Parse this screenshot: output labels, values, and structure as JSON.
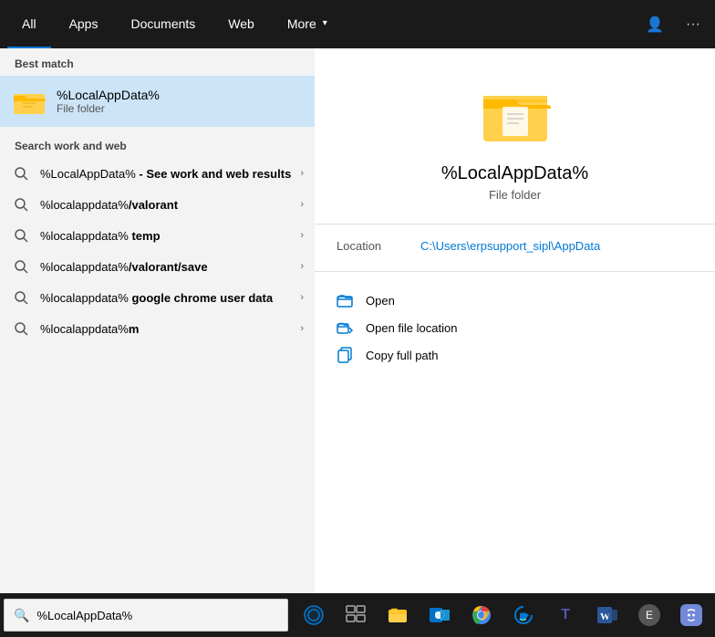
{
  "nav": {
    "tabs": [
      {
        "label": "All",
        "active": true
      },
      {
        "label": "Apps",
        "active": false
      },
      {
        "label": "Documents",
        "active": false
      },
      {
        "label": "Web",
        "active": false
      },
      {
        "label": "More",
        "active": false,
        "has_arrow": true
      }
    ],
    "right_icons": [
      "person-icon",
      "more-icon"
    ]
  },
  "left_panel": {
    "best_match_header": "Best match",
    "best_match": {
      "title": "%LocalAppData%",
      "subtitle": "File folder"
    },
    "search_web_header": "Search work and web",
    "search_items": [
      {
        "text_normal": "%LocalAppData%",
        "text_bold": "",
        "suffix": " - See work and web results"
      },
      {
        "text_normal": "%localappdata%",
        "text_bold": "/valorant",
        "suffix": ""
      },
      {
        "text_normal": "%localappdata%",
        "text_bold": " temp",
        "suffix": ""
      },
      {
        "text_normal": "%localappdata%",
        "text_bold": "/valorant/save",
        "suffix": ""
      },
      {
        "text_normal": "%localappdata%",
        "text_bold": " google chrome user data",
        "suffix": ""
      },
      {
        "text_normal": "%localappdata%",
        "text_bold": "m",
        "suffix": ""
      }
    ]
  },
  "right_panel": {
    "title": "%LocalAppData%",
    "subtitle": "File folder",
    "location_label": "Location",
    "location_value": "C:\\Users\\erpsupport_sipl\\AppData",
    "actions": [
      {
        "label": "Open",
        "icon": "folder-open-icon"
      },
      {
        "label": "Open file location",
        "icon": "folder-location-icon"
      },
      {
        "label": "Copy full path",
        "icon": "copy-icon"
      }
    ]
  },
  "taskbar": {
    "search_value": "%LocalAppData%",
    "search_placeholder": "%LocalAppData%",
    "icons": [
      {
        "name": "search-circle-icon",
        "symbol": "⊙"
      },
      {
        "name": "task-view-icon",
        "symbol": "⧉"
      },
      {
        "name": "file-explorer-icon",
        "symbol": "📁"
      },
      {
        "name": "outlook-icon",
        "symbol": "📧"
      },
      {
        "name": "chrome-icon",
        "symbol": "🌐"
      },
      {
        "name": "edge-icon",
        "symbol": "🌊"
      },
      {
        "name": "teams-icon",
        "symbol": "💼"
      },
      {
        "name": "word-icon",
        "symbol": "W"
      },
      {
        "name": "profile-icon",
        "symbol": "👤"
      },
      {
        "name": "discord-icon",
        "symbol": "🎮"
      }
    ]
  }
}
